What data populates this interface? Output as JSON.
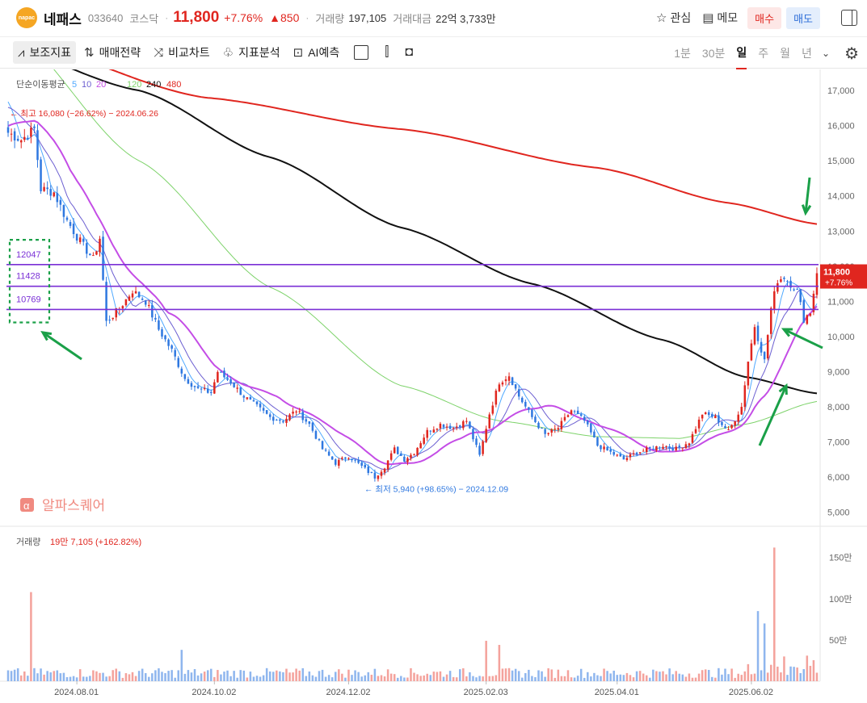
{
  "header": {
    "logo_text": "napac",
    "name": "네패스",
    "code": "033640",
    "market": "코스닥",
    "price": "11,800",
    "change_pct": "+7.76%",
    "change_amt": "▲850",
    "volume_label": "거래량",
    "volume": "197,105",
    "value_label": "거래대금",
    "value": "22억 3,733만",
    "watch_label": "관심",
    "memo_label": "메모",
    "buy_label": "매수",
    "sell_label": "매도"
  },
  "toolbar": {
    "indicators": "보조지표",
    "strategy": "매매전략",
    "compare": "비교차트",
    "analysis": "지표분석",
    "ai": "AI예측",
    "periods": [
      "1분",
      "30분",
      "일",
      "주",
      "월",
      "년"
    ],
    "active_period": "일"
  },
  "colors": {
    "up": "#e0261f",
    "down": "#2f78e0",
    "ma5": "#4fa9ff",
    "ma10": "#6c5fd1",
    "ma20": "#c44de6",
    "ma120": "#7ed36b",
    "ma240": "#111111",
    "ma480": "#e0261f",
    "hline": "#7a2fd6",
    "annotation": "#1aa048"
  },
  "chart_data": {
    "type": "candlestick",
    "ma_legend": {
      "label": "단순이동평균",
      "periods": [
        "5",
        "10",
        "20",
        "120",
        "240",
        "480"
      ]
    },
    "y_ticks": [
      "17,000",
      "16,000",
      "15,000",
      "14,000",
      "13,000",
      "12,000",
      "11,000",
      "10,000",
      "9,000",
      "8,000",
      "7,000",
      "6,000",
      "5,000"
    ],
    "y_tick_values": [
      17000,
      16000,
      15000,
      14000,
      13000,
      12000,
      11000,
      10000,
      9000,
      8000,
      7000,
      6000,
      5000
    ],
    "ylim": [
      4600,
      17600
    ],
    "x_ticks": [
      "2024.08.01",
      "2024.10.02",
      "2024.12.02",
      "2025.02.03",
      "2025.04.01",
      "2025.06.02"
    ],
    "high_annotation": "최고 16,080 (−26.62%) − 2024.06.26",
    "low_annotation": "최저 5,940 (+98.65%) − 2024.12.09",
    "current_price": "11,800",
    "current_change": "+7.76%",
    "horizontal_lines": [
      {
        "label": "12047",
        "value": 12047
      },
      {
        "label": "11428",
        "value": 11428
      },
      {
        "label": "10769",
        "value": 10769
      }
    ],
    "price_path": [
      [
        0,
        15800
      ],
      [
        4,
        15600
      ],
      [
        8,
        15900
      ],
      [
        10,
        14200
      ],
      [
        14,
        14100
      ],
      [
        18,
        13300
      ],
      [
        22,
        12700
      ],
      [
        26,
        12200
      ],
      [
        28,
        12800
      ],
      [
        30,
        10400
      ],
      [
        34,
        10800
      ],
      [
        38,
        11300
      ],
      [
        42,
        11000
      ],
      [
        46,
        10200
      ],
      [
        50,
        9600
      ],
      [
        54,
        8800
      ],
      [
        58,
        8500
      ],
      [
        62,
        8400
      ],
      [
        64,
        9000
      ],
      [
        68,
        8700
      ],
      [
        72,
        8300
      ],
      [
        76,
        8000
      ],
      [
        80,
        7700
      ],
      [
        84,
        7600
      ],
      [
        88,
        7900
      ],
      [
        92,
        7500
      ],
      [
        96,
        6800
      ],
      [
        100,
        6400
      ],
      [
        104,
        6600
      ],
      [
        108,
        6300
      ],
      [
        112,
        6000
      ],
      [
        115,
        6300
      ],
      [
        118,
        6800
      ],
      [
        121,
        6500
      ],
      [
        124,
        6700
      ],
      [
        128,
        7300
      ],
      [
        132,
        7500
      ],
      [
        136,
        7400
      ],
      [
        140,
        7600
      ],
      [
        144,
        6600
      ],
      [
        147,
        7800
      ],
      [
        150,
        8700
      ],
      [
        153,
        8900
      ],
      [
        156,
        8300
      ],
      [
        160,
        7700
      ],
      [
        164,
        7200
      ],
      [
        168,
        7400
      ],
      [
        172,
        7900
      ],
      [
        176,
        7600
      ],
      [
        180,
        6900
      ],
      [
        184,
        6700
      ],
      [
        188,
        6500
      ],
      [
        192,
        6700
      ],
      [
        196,
        6800
      ],
      [
        200,
        6900
      ],
      [
        204,
        6800
      ],
      [
        208,
        7000
      ],
      [
        212,
        7800
      ],
      [
        216,
        7700
      ],
      [
        220,
        7300
      ],
      [
        224,
        8000
      ],
      [
        226,
        9300
      ],
      [
        228,
        10300
      ],
      [
        231,
        9300
      ],
      [
        233,
        10800
      ],
      [
        235,
        11600
      ],
      [
        237,
        11700
      ],
      [
        239,
        11500
      ],
      [
        241,
        11300
      ],
      [
        243,
        10500
      ],
      [
        245,
        10700
      ],
      [
        247,
        11800
      ]
    ],
    "total_days": 248,
    "volume_panel": {
      "label": "거래량",
      "value": "19만 7,105 (+162.82%)",
      "y_ticks": [
        "150만",
        "100만",
        "50만"
      ],
      "y_tick_values": [
        1500000,
        1000000,
        500000
      ],
      "ylim": [
        0,
        1800000
      ],
      "spikes": [
        {
          "day": 7,
          "volume": 1080000
        },
        {
          "day": 53,
          "volume": 380000
        },
        {
          "day": 146,
          "volume": 490000
        },
        {
          "day": 150,
          "volume": 440000
        },
        {
          "day": 229,
          "volume": 850000
        },
        {
          "day": 231,
          "volume": 700000
        },
        {
          "day": 234,
          "volume": 1620000
        },
        {
          "day": 237,
          "volume": 300000
        },
        {
          "day": 244,
          "volume": 310000
        }
      ]
    },
    "watermark": "알파스퀘어"
  }
}
